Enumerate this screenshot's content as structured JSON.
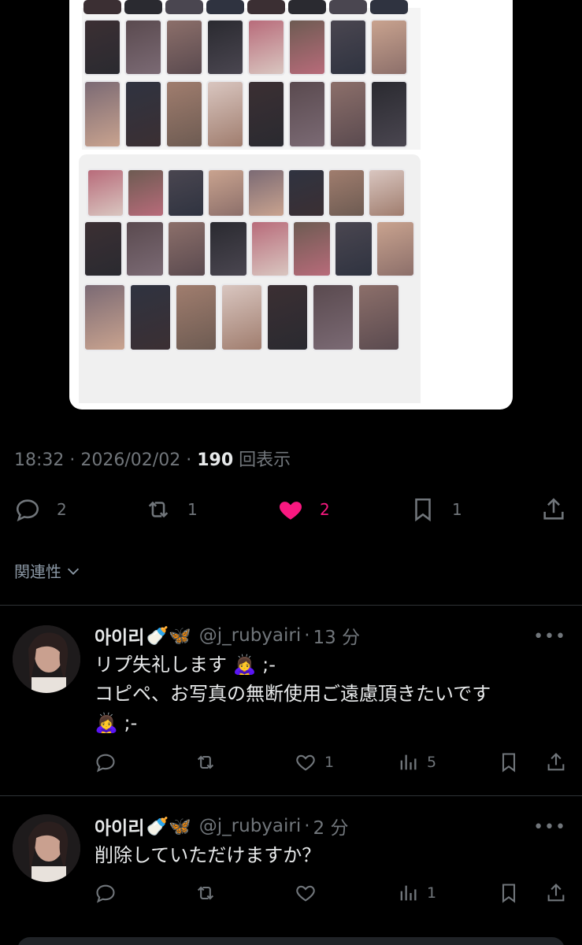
{
  "tweet": {
    "time": "18:32",
    "date": "2026/02/02",
    "views": "190",
    "views_label": "回表示",
    "replies": "2",
    "retweets": "1",
    "likes": "2",
    "bookmarks": "1",
    "like_color": "#f91880"
  },
  "related": {
    "label": "関連性"
  },
  "replies": [
    {
      "name": "아이리",
      "emoji": "🍼🦋",
      "handle": "@j_rubyairi",
      "time": "13 分",
      "lines": [
        "リプ失礼します 🙇‍♀️ ;-",
        "コピペ、お写真の無断使用ご遠慮頂きたいです",
        "🙇‍♀️ ;-"
      ],
      "likes": "1",
      "views": "5"
    },
    {
      "name": "아이리",
      "emoji": "🍼🦋",
      "handle": "@j_rubyairi",
      "time": "2 分",
      "lines": [
        "削除していただけますか？"
      ],
      "likes": "",
      "views": "1"
    }
  ]
}
